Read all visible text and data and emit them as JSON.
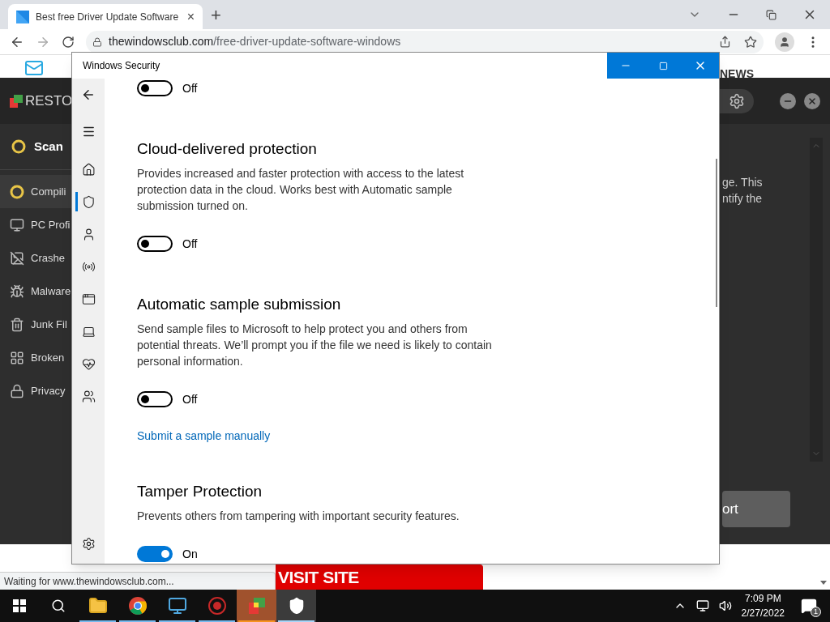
{
  "browser": {
    "tab": {
      "title": "Best free Driver Update Software",
      "close": "×"
    },
    "new_tab": "+",
    "url": {
      "host": "thewindowsclub.com",
      "path": "/free-driver-update-software-windows"
    },
    "status": "Waiting for www.thewindowsclub.com..."
  },
  "web_page": {
    "nav_text": "NEWS",
    "banner": "VISIT SITE",
    "app": {
      "logo": "RESTO",
      "scan": "Scan",
      "items": [
        {
          "label": "Compili",
          "selected": true
        },
        {
          "label": "PC Profi",
          "selected": false
        },
        {
          "label": "Crashe",
          "selected": false
        },
        {
          "label": "Malware",
          "selected": false
        },
        {
          "label": "Junk Fil",
          "selected": false
        },
        {
          "label": "Broken",
          "selected": false
        },
        {
          "label": "Privacy",
          "selected": false
        }
      ],
      "text_lines": [
        "ge. This",
        "ntify the"
      ],
      "button": "ort"
    }
  },
  "window": {
    "title": "Windows Security",
    "nav_items": [
      {
        "selected": false
      },
      {
        "selected": true
      },
      {
        "selected": false
      },
      {
        "selected": false
      },
      {
        "selected": false
      },
      {
        "selected": false
      },
      {
        "selected": false
      },
      {
        "selected": false
      }
    ],
    "sections": [
      {
        "toggle": {
          "on": false,
          "label": "Off"
        }
      },
      {
        "title": "Cloud-delivered protection",
        "description": "Provides increased and faster protection with access to the latest protection data in the cloud. Works best with Automatic sample submission turned on.",
        "toggle": {
          "on": false,
          "label": "Off"
        }
      },
      {
        "title": "Automatic sample submission",
        "description": "Send sample files to Microsoft to help protect you and others from potential threats. We’ll prompt you if the file we need is likely to contain personal information.",
        "toggle": {
          "on": false,
          "label": "Off"
        },
        "link": "Submit a sample manually"
      },
      {
        "title": "Tamper Protection",
        "description": "Prevents others from tampering with important security features.",
        "toggle": {
          "on": true,
          "label": "On"
        }
      }
    ]
  },
  "taskbar": {
    "apps": [
      {
        "active": false,
        "flashing": false
      },
      {
        "active": false,
        "flashing": false
      },
      {
        "active": false,
        "flashing": false
      },
      {
        "active": false,
        "flashing": false
      },
      {
        "active": false,
        "flashing": true
      },
      {
        "active": true,
        "flashing": false
      }
    ],
    "time": "7:09 PM",
    "date": "2/27/2022",
    "notifications": "1"
  }
}
